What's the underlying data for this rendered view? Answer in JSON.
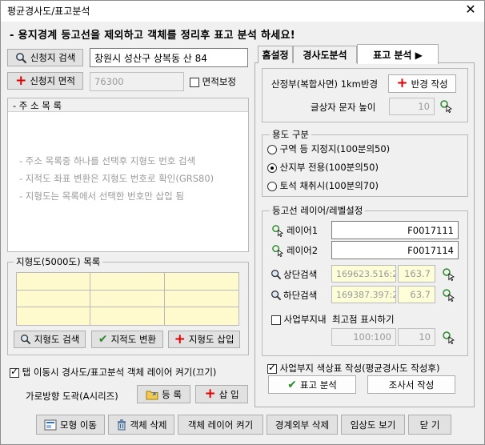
{
  "window": {
    "title": "평균경사도/표고분석",
    "close_glyph": "✕"
  },
  "notice": "- 용지경계 등고선을 제외하고 객체를 정리후 표고 분석 하세요!",
  "left": {
    "search_button": "신청지 검색",
    "search_value": "창원시 성산구 상복동 산 84",
    "area_button": "신청지 면적",
    "area_value": "76300",
    "area_correction_label": "면적보정",
    "address_group": "- 주 소 목 록",
    "address_hints": [
      "- 주소 목록중 하나를 선택후 지형도 번호 검색",
      "- 지적도 좌표 변환은 지형도 번호로 확인(GRS80)",
      "- 지형도는 목록에서 선택한 번호만 삽입 됨"
    ],
    "map_group": "지형도(5000도) 목록",
    "map_search_button": "지형도 검색",
    "cadastral_convert_button": "지적도 변환",
    "map_insert_button": "지형도 삽입",
    "tab_layer_toggle_label": "탭 이동시 경사도/표고분석 객체 레이어 켜기(끄기)",
    "horizontal_label": "가로방향 도곽(A시리즈)",
    "register_button": "등 록",
    "insert_button": "삽 입"
  },
  "tabs": [
    "홈설정",
    "경사도분석",
    "표고 분석 ▶"
  ],
  "right": {
    "slope_label": "산정부(복합사면) 1km반경",
    "radius_button": "반경 작성",
    "text_height_label": "글상자 문자 높이",
    "text_height_value": "10",
    "usage_group": "용도 구분",
    "usage_options": [
      {
        "label": "구역 등 지정지(100분의50)",
        "selected": false
      },
      {
        "label": "산지부 전용(100분의50)",
        "selected": true
      },
      {
        "label": "토석 채취시(100분의70)",
        "selected": false
      }
    ],
    "contour_group": "등고선 레이어/레벨설정",
    "layer1_label": "레이어1",
    "layer1_value": "F0017111",
    "layer2_label": "레이어2",
    "layer2_value": "F0017114",
    "upper_search_label": "상단검색",
    "upper_coord": "169623.516:2",
    "upper_level": "163.7",
    "lower_search_label": "하단검색",
    "lower_coord": "169387.397:2",
    "lower_level": "63.7",
    "max_point_label": "사업부지내  최고점 표시하기",
    "max_point_value1": "100:100",
    "max_point_value2": "10",
    "color_table_label": "사업부지 색상표 작성(평균경사도 작성후)",
    "elevation_button": "표고 분석",
    "survey_button": "조사서 작성"
  },
  "bottom_buttons": [
    "모형 이동",
    "객체 삭제",
    "객체 레이어 켜기",
    "경계외부 삭제",
    "임상도 보기",
    "닫 기"
  ],
  "colors": {
    "grid_fill": "#fffacd",
    "plus_red": "#e00000",
    "check_green": "#2a8a2a"
  }
}
